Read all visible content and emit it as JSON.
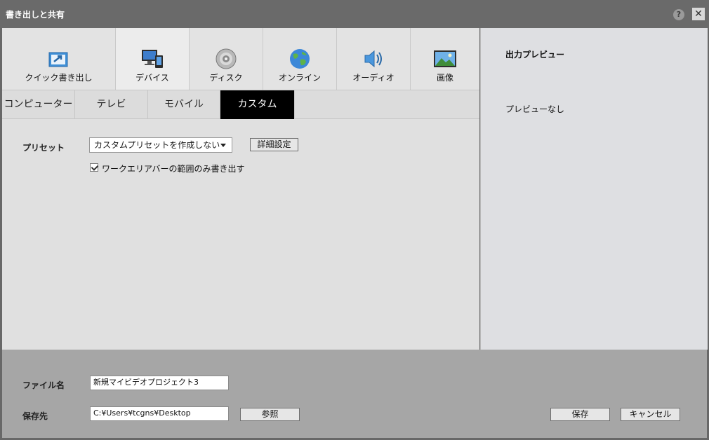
{
  "window": {
    "title": "書き出しと共有",
    "help_symbol": "?",
    "close_symbol": "✕"
  },
  "categories": [
    {
      "id": "quick",
      "label": "クイック書き出し",
      "icon": "quick-export-icon"
    },
    {
      "id": "device",
      "label": "デバイス",
      "icon": "device-icon",
      "active": true
    },
    {
      "id": "disc",
      "label": "ディスク",
      "icon": "disc-icon"
    },
    {
      "id": "online",
      "label": "オンライン",
      "icon": "globe-icon"
    },
    {
      "id": "audio",
      "label": "オーディオ",
      "icon": "speaker-icon"
    },
    {
      "id": "image",
      "label": "画像",
      "icon": "image-icon"
    }
  ],
  "subtabs": [
    {
      "label": "コンピューター"
    },
    {
      "label": "テレビ"
    },
    {
      "label": "モバイル"
    },
    {
      "label": "カスタム",
      "active": true
    }
  ],
  "settings": {
    "preset_label": "プリセット",
    "preset_value": "カスタムプリセットを作成しない",
    "detail_button": "詳細設定",
    "checkbox_label": "ワークエリアバーの範囲のみ書き出す",
    "checkbox_checked": true
  },
  "preview": {
    "title": "出力プレビュー",
    "empty_text": "プレビューなし"
  },
  "bottom": {
    "filename_label": "ファイル名",
    "filename_value": "新規マイビデオプロジェクト3",
    "dest_label": "保存先",
    "dest_value": "C:¥Users¥tcgns¥Desktop",
    "browse_button": "参照",
    "save_button": "保存",
    "cancel_button": "キャンセル"
  },
  "colors": {
    "titlebar": "#6a6a6a",
    "active_subtab": "#000000",
    "panel": "#e0e0e0",
    "bottom": "#a6a6a6"
  }
}
